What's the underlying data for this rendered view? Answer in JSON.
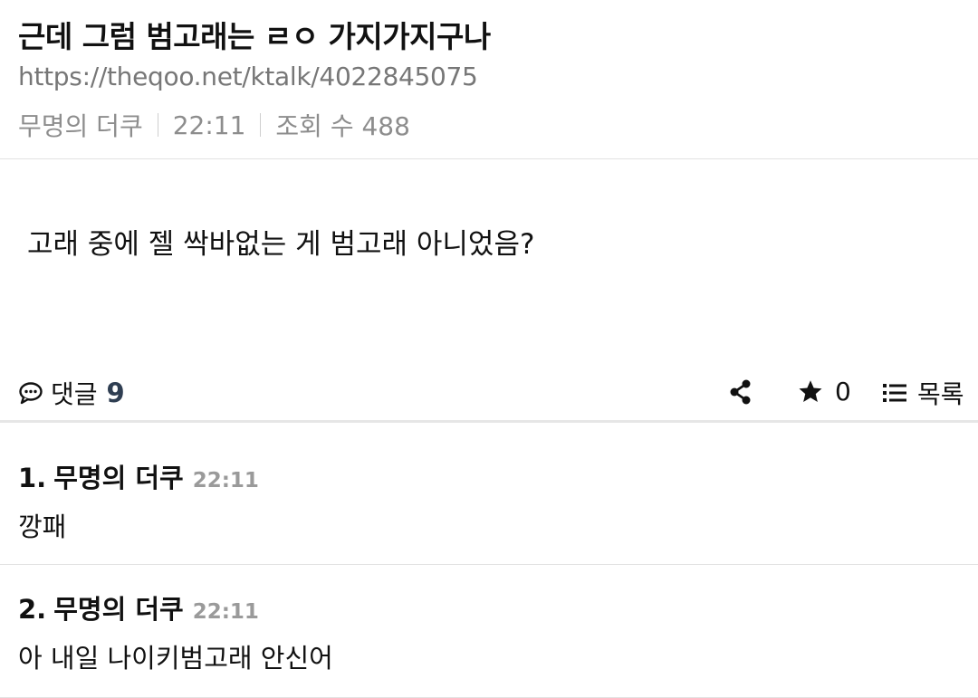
{
  "post": {
    "title": "근데 그럼 범고래는 ㄹㅇ 가지가지구나",
    "url": "https://theqoo.net/ktalk/4022845075",
    "author": "무명의 더쿠",
    "time": "22:11",
    "views_label": "조회 수 488",
    "body": "고래 중에 젤 싹바없는 게 범고래 아니었음?"
  },
  "actions": {
    "comments_label": "댓글",
    "comments_count": "9",
    "star_count": "0",
    "list_label": "목록",
    "icons": [
      "comment-icon",
      "share-icon",
      "star-icon",
      "list-icon"
    ]
  },
  "comments": [
    {
      "index": "1.",
      "author": "무명의 더쿠",
      "time": "22:11",
      "text": "깡패"
    },
    {
      "index": "2.",
      "author": "무명의 더쿠",
      "time": "22:11",
      "text": "아 내일 나이키범고래 안신어"
    }
  ]
}
